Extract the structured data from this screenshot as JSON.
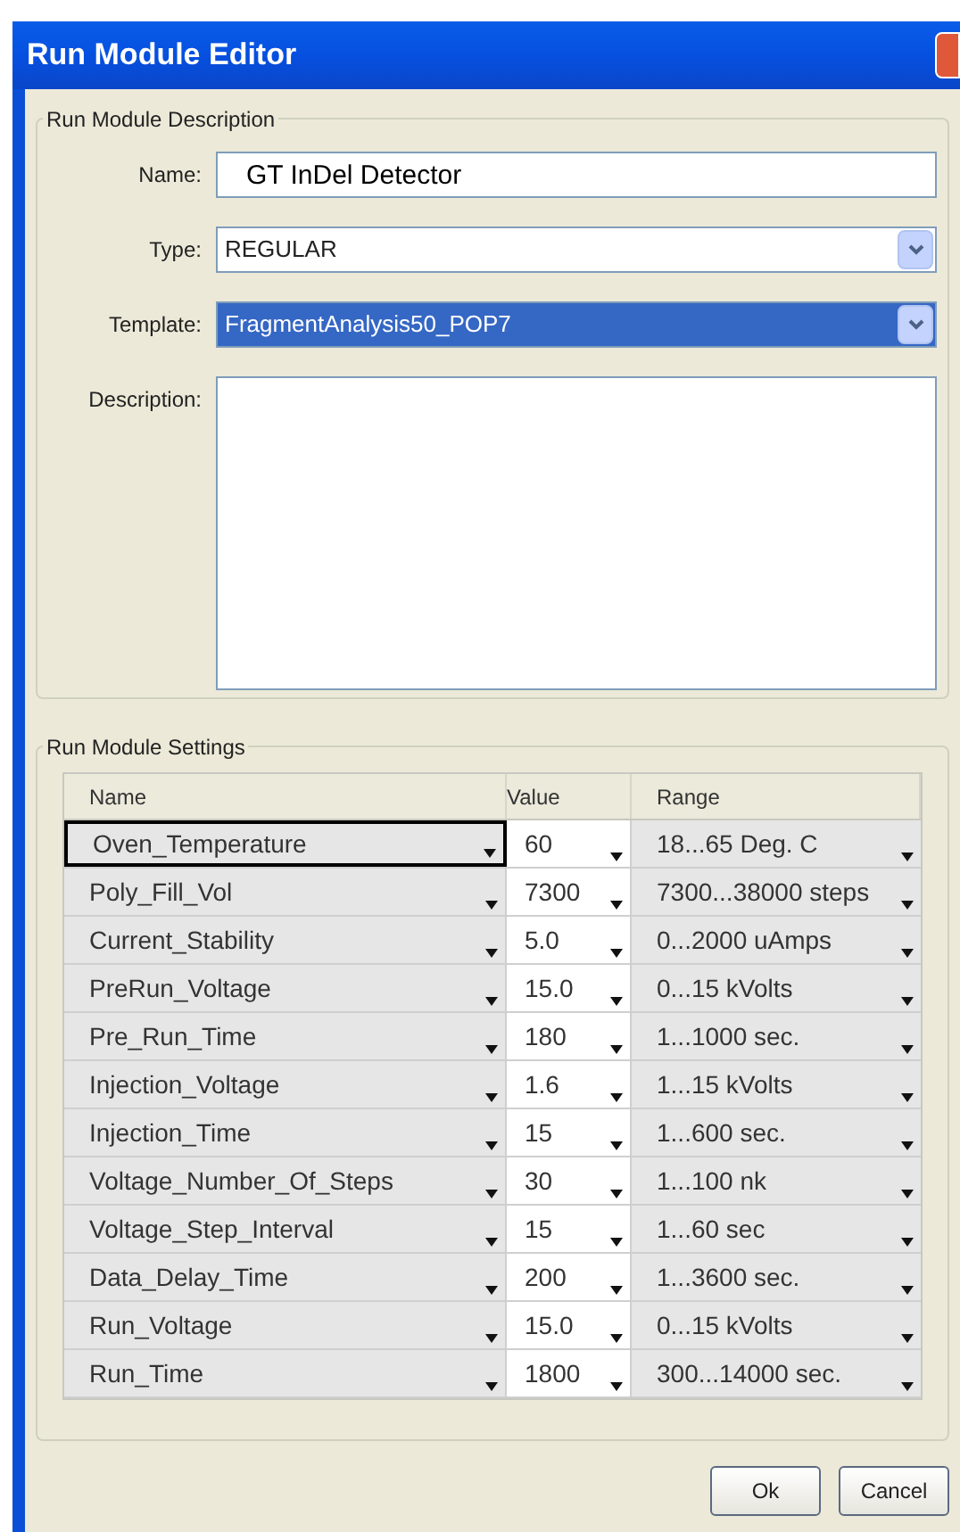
{
  "window": {
    "title": "Run Module Editor"
  },
  "description_group": {
    "title": "Run Module Description",
    "fields": [
      {
        "kind": "text",
        "label": "Name:",
        "value": "GT InDel Detector"
      },
      {
        "kind": "select",
        "label": "Type:",
        "value": "REGULAR",
        "selected": false
      },
      {
        "kind": "select",
        "label": "Template:",
        "value": "FragmentAnalysis50_POP7",
        "selected": true
      },
      {
        "kind": "textarea",
        "label": "Description:"
      }
    ]
  },
  "settings_group": {
    "title": "Run Module Settings",
    "columns": [
      "Name",
      "Value",
      "Range"
    ],
    "rows": [
      {
        "name": "Oven_Temperature",
        "value": "60",
        "range": "18...65 Deg. C",
        "selected": true
      },
      {
        "name": "Poly_Fill_Vol",
        "value": "7300",
        "range": "7300...38000 steps",
        "selected": false
      },
      {
        "name": "Current_Stability",
        "value": "5.0",
        "range": "0...2000 uAmps",
        "selected": false
      },
      {
        "name": "PreRun_Voltage",
        "value": "15.0",
        "range": "0...15 kVolts",
        "selected": false
      },
      {
        "name": "Pre_Run_Time",
        "value": "180",
        "range": "1...1000 sec.",
        "selected": false
      },
      {
        "name": "Injection_Voltage",
        "value": "1.6",
        "range": "1...15 kVolts",
        "selected": false
      },
      {
        "name": "Injection_Time",
        "value": "15",
        "range": "1...600 sec.",
        "selected": false
      },
      {
        "name": "Voltage_Number_Of_Steps",
        "value": "30",
        "range": "1...100 nk",
        "selected": false
      },
      {
        "name": "Voltage_Step_Interval",
        "value": "15",
        "range": "1...60 sec",
        "selected": false
      },
      {
        "name": "Data_Delay_Time",
        "value": "200",
        "range": "1...3600 sec.",
        "selected": false
      },
      {
        "name": "Run_Voltage",
        "value": "15.0",
        "range": "0...15 kVolts",
        "selected": false
      },
      {
        "name": "Run_Time",
        "value": "1800",
        "range": "300...14000 sec.",
        "selected": false
      }
    ]
  },
  "buttons": [
    "Ok",
    "Cancel"
  ]
}
